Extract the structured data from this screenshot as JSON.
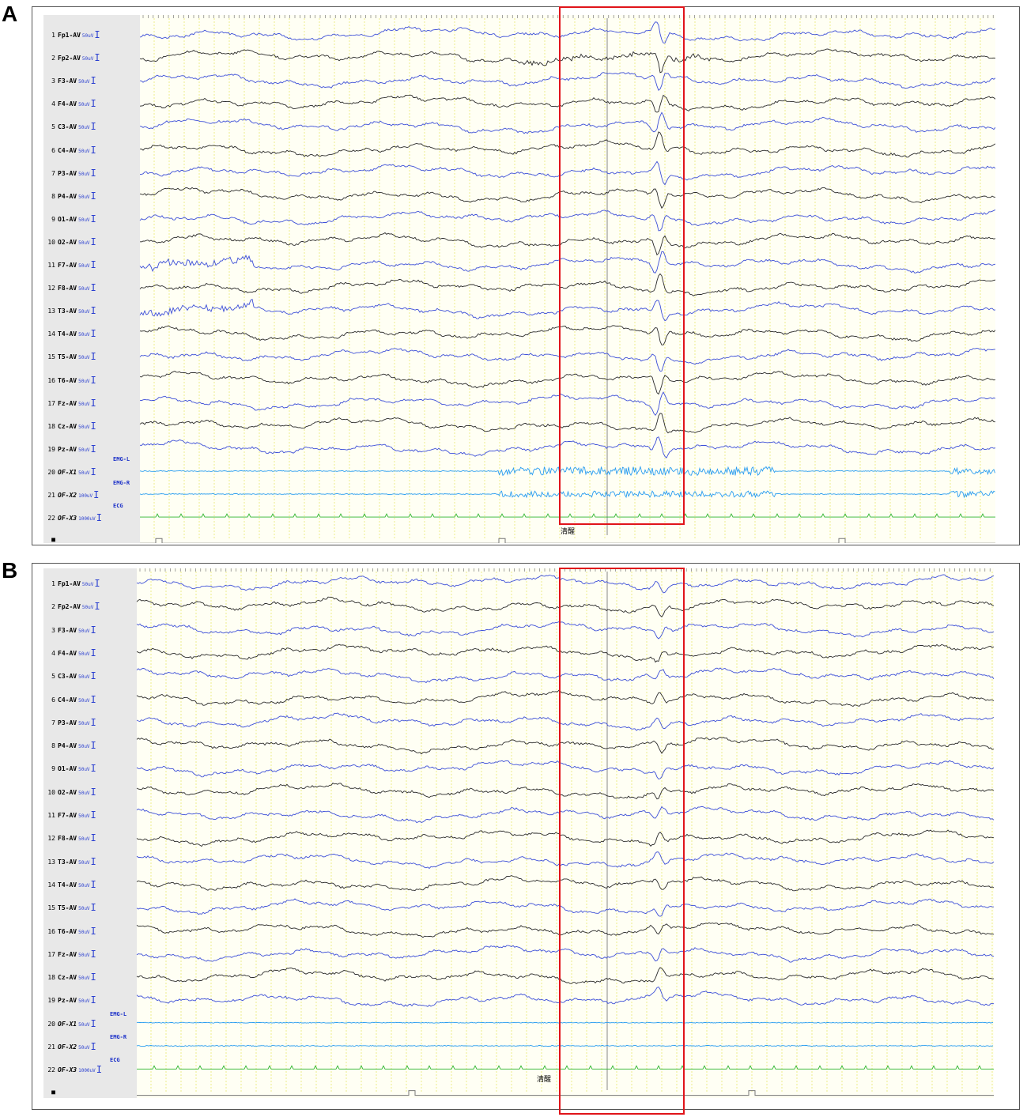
{
  "panels": [
    {
      "letter": "A",
      "event_label": "清醒",
      "aux_labels": [
        "EMG-L",
        "EMG-R",
        "ECG"
      ],
      "channels": [
        {
          "num": "1",
          "name": "Fp1-AV",
          "sens": "50uV"
        },
        {
          "num": "2",
          "name": "Fp2-AV",
          "sens": "50uV"
        },
        {
          "num": "3",
          "name": "F3-AV",
          "sens": "50uV"
        },
        {
          "num": "4",
          "name": "F4-AV",
          "sens": "50uV"
        },
        {
          "num": "5",
          "name": "C3-AV",
          "sens": "50uV"
        },
        {
          "num": "6",
          "name": "C4-AV",
          "sens": "50uV"
        },
        {
          "num": "7",
          "name": "P3-AV",
          "sens": "50uV"
        },
        {
          "num": "8",
          "name": "P4-AV",
          "sens": "50uV"
        },
        {
          "num": "9",
          "name": "O1-AV",
          "sens": "50uV"
        },
        {
          "num": "10",
          "name": "O2-AV",
          "sens": "50uV"
        },
        {
          "num": "11",
          "name": "F7-AV",
          "sens": "50uV"
        },
        {
          "num": "12",
          "name": "F8-AV",
          "sens": "50uV"
        },
        {
          "num": "13",
          "name": "T3-AV",
          "sens": "50uV"
        },
        {
          "num": "14",
          "name": "T4-AV",
          "sens": "50uV"
        },
        {
          "num": "15",
          "name": "T5-AV",
          "sens": "50uV"
        },
        {
          "num": "16",
          "name": "T6-AV",
          "sens": "50uV"
        },
        {
          "num": "17",
          "name": "Fz-AV",
          "sens": "50uV"
        },
        {
          "num": "18",
          "name": "Cz-AV",
          "sens": "50uV"
        },
        {
          "num": "19",
          "name": "Pz-AV",
          "sens": "50uV"
        },
        {
          "num": "20",
          "name": "OF-X1",
          "sens": "50uV"
        },
        {
          "num": "21",
          "name": "OF-X2",
          "sens": "100uV"
        },
        {
          "num": "22",
          "name": "OF-X3",
          "sens": "1000uV"
        },
        {
          "num": "■",
          "name": "",
          "sens": ""
        }
      ]
    },
    {
      "letter": "B",
      "event_label": "清醒",
      "aux_labels": [
        "EMG-L",
        "EMG-R",
        "ECG"
      ],
      "channels": [
        {
          "num": "1",
          "name": "Fp1-AV",
          "sens": "50uV"
        },
        {
          "num": "2",
          "name": "Fp2-AV",
          "sens": "50uV"
        },
        {
          "num": "3",
          "name": "F3-AV",
          "sens": "50uV"
        },
        {
          "num": "4",
          "name": "F4-AV",
          "sens": "50uV"
        },
        {
          "num": "5",
          "name": "C3-AV",
          "sens": "50uV"
        },
        {
          "num": "6",
          "name": "C4-AV",
          "sens": "50uV"
        },
        {
          "num": "7",
          "name": "P3-AV",
          "sens": "50uV"
        },
        {
          "num": "8",
          "name": "P4-AV",
          "sens": "50uV"
        },
        {
          "num": "9",
          "name": "O1-AV",
          "sens": "50uV"
        },
        {
          "num": "10",
          "name": "O2-AV",
          "sens": "50uV"
        },
        {
          "num": "11",
          "name": "F7-AV",
          "sens": "50uV"
        },
        {
          "num": "12",
          "name": "F8-AV",
          "sens": "50uV"
        },
        {
          "num": "13",
          "name": "T3-AV",
          "sens": "50uV"
        },
        {
          "num": "14",
          "name": "T4-AV",
          "sens": "50uV"
        },
        {
          "num": "15",
          "name": "T5-AV",
          "sens": "50uV"
        },
        {
          "num": "16",
          "name": "T6-AV",
          "sens": "50uV"
        },
        {
          "num": "17",
          "name": "Fz-AV",
          "sens": "50uV"
        },
        {
          "num": "18",
          "name": "Cz-AV",
          "sens": "50uV"
        },
        {
          "num": "19",
          "name": "Pz-AV",
          "sens": "50uV"
        },
        {
          "num": "20",
          "name": "OF-X1",
          "sens": "50uV"
        },
        {
          "num": "21",
          "name": "OF-X2",
          "sens": "50uV"
        },
        {
          "num": "22",
          "name": "OF-X3",
          "sens": "1000uV"
        },
        {
          "num": "■",
          "name": "",
          "sens": ""
        }
      ]
    }
  ],
  "colors": {
    "trace_blue": "#3d4fd8",
    "trace_black": "#2a2a2a",
    "emg": "#2a9df0",
    "ecg": "#2fb52f",
    "grid_yellow": "#ecec8a",
    "highlight_box": "#e0141a"
  }
}
